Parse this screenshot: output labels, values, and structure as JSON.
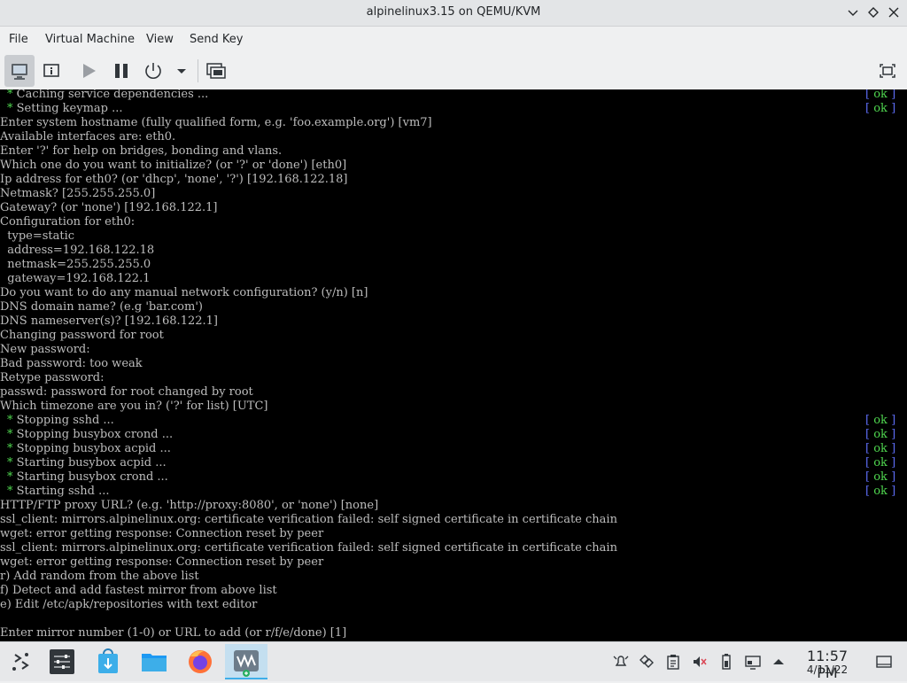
{
  "window": {
    "title": "alpinelinux3.15 on QEMU/KVM"
  },
  "menu": [
    "File",
    "Virtual Machine",
    "View",
    "Send Key"
  ],
  "toolbar": {
    "icons": [
      "monitor-icon",
      "details-icon",
      "run-icon",
      "pause-icon",
      "power-icon",
      "power-dropdown-icon",
      "snapshots-icon",
      "fullscreen-icon"
    ]
  },
  "console": {
    "lines": [
      {
        "text": "Caching service dependencies ...",
        "bullet": true,
        "ok": true
      },
      {
        "text": "Setting keymap ...",
        "bullet": true,
        "ok": true
      },
      {
        "text": "Enter system hostname (fully qualified form, e.g. 'foo.example.org') [vm7]"
      },
      {
        "text": "Available interfaces are: eth0."
      },
      {
        "text": "Enter '?' for help on bridges, bonding and vlans."
      },
      {
        "text": "Which one do you want to initialize? (or '?' or 'done') [eth0]"
      },
      {
        "text": "Ip address for eth0? (or 'dhcp', 'none', '?') [192.168.122.18]"
      },
      {
        "text": "Netmask? [255.255.255.0]"
      },
      {
        "text": "Gateway? (or 'none') [192.168.122.1]"
      },
      {
        "text": "Configuration for eth0:"
      },
      {
        "text": "  type=static"
      },
      {
        "text": "  address=192.168.122.18"
      },
      {
        "text": "  netmask=255.255.255.0"
      },
      {
        "text": "  gateway=192.168.122.1"
      },
      {
        "text": "Do you want to do any manual network configuration? (y/n) [n]"
      },
      {
        "text": "DNS domain name? (e.g 'bar.com')"
      },
      {
        "text": "DNS nameserver(s)? [192.168.122.1]"
      },
      {
        "text": "Changing password for root"
      },
      {
        "text": "New password:"
      },
      {
        "text": "Bad password: too weak"
      },
      {
        "text": "Retype password:"
      },
      {
        "text": "passwd: password for root changed by root"
      },
      {
        "text": "Which timezone are you in? ('?' for list) [UTC]"
      },
      {
        "text": "Stopping sshd ...",
        "bullet": true,
        "ok": true
      },
      {
        "text": "Stopping busybox crond ...",
        "bullet": true,
        "ok": true
      },
      {
        "text": "Stopping busybox acpid ...",
        "bullet": true,
        "ok": true
      },
      {
        "text": "Starting busybox acpid ...",
        "bullet": true,
        "ok": true
      },
      {
        "text": "Starting busybox crond ...",
        "bullet": true,
        "ok": true
      },
      {
        "text": "Starting sshd ...",
        "bullet": true,
        "ok": true
      },
      {
        "text": "HTTP/FTP proxy URL? (e.g. 'http://proxy:8080', or 'none') [none]"
      },
      {
        "text": "ssl_client: mirrors.alpinelinux.org: certificate verification failed: self signed certificate in certificate chain"
      },
      {
        "text": "wget: error getting response: Connection reset by peer"
      },
      {
        "text": "ssl_client: mirrors.alpinelinux.org: certificate verification failed: self signed certificate in certificate chain"
      },
      {
        "text": "wget: error getting response: Connection reset by peer"
      },
      {
        "text": "r) Add random from the above list"
      },
      {
        "text": "f) Detect and add fastest mirror from above list"
      },
      {
        "text": "e) Edit /etc/apk/repositories with text editor"
      },
      {
        "text": ""
      },
      {
        "text": "Enter mirror number (1-0) or URL to add (or r/f/e/done) [1]"
      }
    ],
    "bullet": "*",
    "ok_open": "[ ",
    "ok_word": "ok",
    "ok_close": " ]",
    "colors": {
      "text": "#bdbdbd",
      "ok": "#4fd64f",
      "bracket": "#5c6bf2",
      "bg": "#000000"
    }
  },
  "taskbar": {
    "apps": [
      "application-launcher-icon",
      "system-settings-icon",
      "discover-store-icon",
      "file-manager-icon",
      "firefox-icon",
      "virt-manager-icon"
    ],
    "tray": [
      "notifications-icon",
      "kde-connect-icon",
      "clipboard-icon",
      "volume-muted-icon",
      "battery-icon",
      "display-icon",
      "tray-expand-icon",
      "show-desktop-icon"
    ],
    "clock_time": "11:57 PM",
    "clock_date": "4/11/22"
  }
}
